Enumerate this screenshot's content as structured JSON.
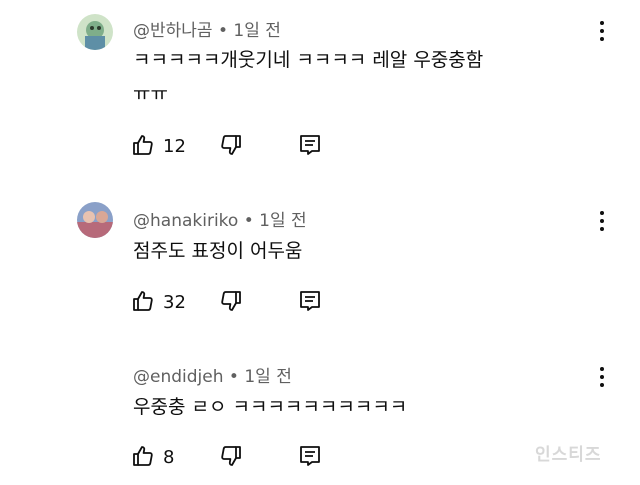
{
  "comments": [
    {
      "author": "@반하나곰",
      "dot": "•",
      "time": "1일 전",
      "lines": [
        "ㅋㅋㅋㅋㅋ개웃기네 ㅋㅋㅋㅋ 레알 우중충함",
        "ㅠㅠ"
      ],
      "likes": "12"
    },
    {
      "author": "@hanakiriko",
      "dot": "•",
      "time": "1일 전",
      "lines": [
        "점주도 표정이 어두움"
      ],
      "likes": "32"
    },
    {
      "author": "@endidjeh",
      "dot": "•",
      "time": "1일 전",
      "lines": [
        "우중충 ㄹㅇ ㅋㅋㅋㅋㅋㅋㅋㅋㅋㅋ"
      ],
      "likes": "8"
    }
  ],
  "watermark": "인스티즈",
  "icons": {
    "like": "thumbs-up-icon",
    "dislike": "thumbs-down-icon",
    "reply": "reply-icon",
    "more": "more-vertical-icon"
  }
}
